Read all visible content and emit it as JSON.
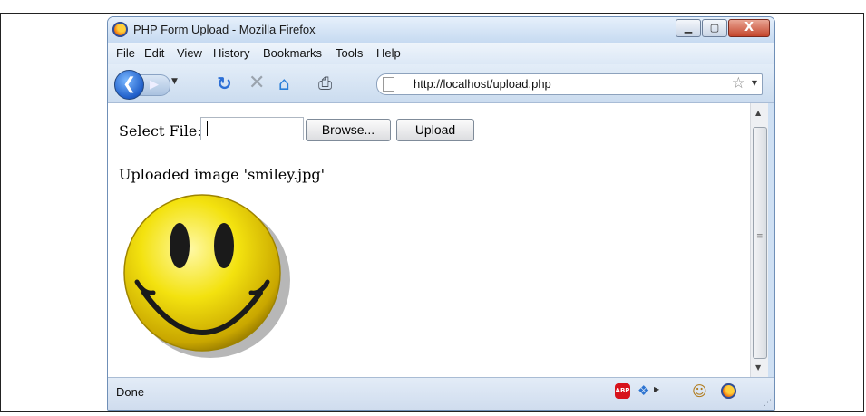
{
  "window": {
    "title": "PHP Form Upload - Mozilla Firefox",
    "controls": {
      "minimize": "▁",
      "maximize": "▢",
      "close": "X"
    }
  },
  "menu": [
    "File",
    "Edit",
    "View",
    "History",
    "Bookmarks",
    "Tools",
    "Help"
  ],
  "nav": {
    "back_icon": "back-arrow-icon",
    "forward_icon": "forward-arrow-icon",
    "url": "http://localhost/upload.php"
  },
  "form": {
    "select_label": "Select File:",
    "browse_label": "Browse...",
    "upload_label": "Upload"
  },
  "result": {
    "message": "Uploaded image 'smiley.jpg'"
  },
  "statusbar": {
    "text": "Done",
    "adblock_text": "ABP"
  },
  "colors": {
    "accent": "#1f5ec9",
    "smiley_yellow": "#f3e20f"
  }
}
